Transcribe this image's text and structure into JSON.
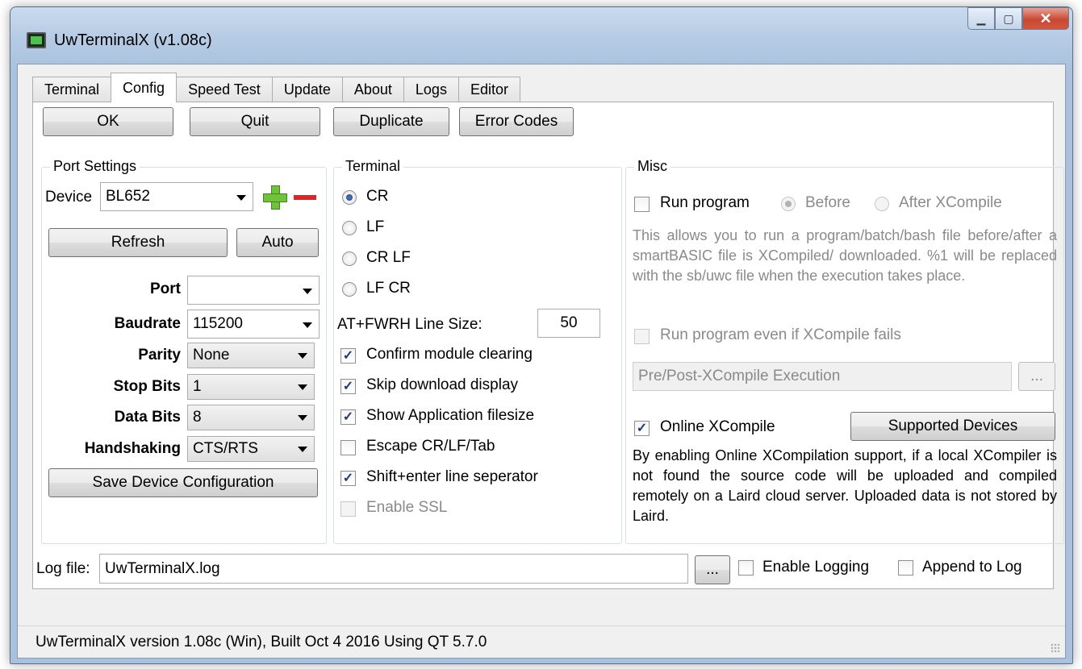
{
  "window": {
    "title": "UwTerminalX (v1.08c)"
  },
  "tabs": [
    "Terminal",
    "Config",
    "Speed Test",
    "Update",
    "About",
    "Logs",
    "Editor"
  ],
  "buttons": {
    "ok": "OK",
    "quit": "Quit",
    "duplicate": "Duplicate",
    "error_codes": "Error Codes"
  },
  "port_settings": {
    "title": "Port Settings",
    "device_label": "Device",
    "device_value": "BL652",
    "refresh": "Refresh",
    "auto": "Auto",
    "fields": [
      {
        "label": "Port",
        "value": ""
      },
      {
        "label": "Baudrate",
        "value": "115200"
      },
      {
        "label": "Parity",
        "value": "None"
      },
      {
        "label": "Stop Bits",
        "value": "1"
      },
      {
        "label": "Data Bits",
        "value": "8"
      },
      {
        "label": "Handshaking",
        "value": "CTS/RTS"
      }
    ],
    "save": "Save Device Configuration"
  },
  "terminal": {
    "title": "Terminal",
    "line_endings": [
      {
        "label": "CR",
        "selected": true
      },
      {
        "label": "LF",
        "selected": false
      },
      {
        "label": "CR LF",
        "selected": false
      },
      {
        "label": "LF CR",
        "selected": false
      }
    ],
    "fwrh_label": "AT+FWRH Line Size:",
    "fwrh_value": "50",
    "options": [
      {
        "label": "Confirm module clearing",
        "checked": true,
        "enabled": true
      },
      {
        "label": "Skip download display",
        "checked": true,
        "enabled": true
      },
      {
        "label": "Show Application filesize",
        "checked": true,
        "enabled": true
      },
      {
        "label": "Escape CR/LF/Tab",
        "checked": false,
        "enabled": true
      },
      {
        "label": "Shift+enter line seperator",
        "checked": true,
        "enabled": true
      },
      {
        "label": "Enable SSL",
        "checked": false,
        "enabled": false
      }
    ]
  },
  "misc": {
    "title": "Misc",
    "run_program": "Run program",
    "before": "Before",
    "after": "After XCompile",
    "description": "This allows you to run a program/batch/bash file before/after a smartBASIC file is XCompiled/ downloaded. %1 will be replaced with the sb/uwc file when the execution takes place.",
    "run_even_if_fails": "Run program even if XCompile fails",
    "execution_placeholder": "Pre/Post-XCompile Execution",
    "browse": "...",
    "online_xcompile": "Online XCompile",
    "supported_devices": "Supported Devices",
    "online_description": "By enabling Online XCompilation support, if a local XCompiler is not found the source code will be uploaded and compiled remotely on a Laird cloud server. Uploaded data is not stored by Laird."
  },
  "logging": {
    "label": "Log file:",
    "file": "UwTerminalX.log",
    "browse": "...",
    "enable": "Enable Logging",
    "append": "Append to Log"
  },
  "status": "UwTerminalX version 1.08c (Win), Built Oct  4 2016 Using QT 5.7.0",
  "icons": [
    "app-icon",
    "minimize-icon",
    "maximize-icon",
    "close-icon",
    "add-device-icon",
    "remove-device-icon",
    "dropdown-arrow-icon"
  ],
  "colors": {
    "titlebar": "#b5cbe4",
    "close_button": "#c74a32",
    "add_icon": "#6fc23a",
    "remove_icon": "#d42a2a",
    "check": "#21397a"
  }
}
